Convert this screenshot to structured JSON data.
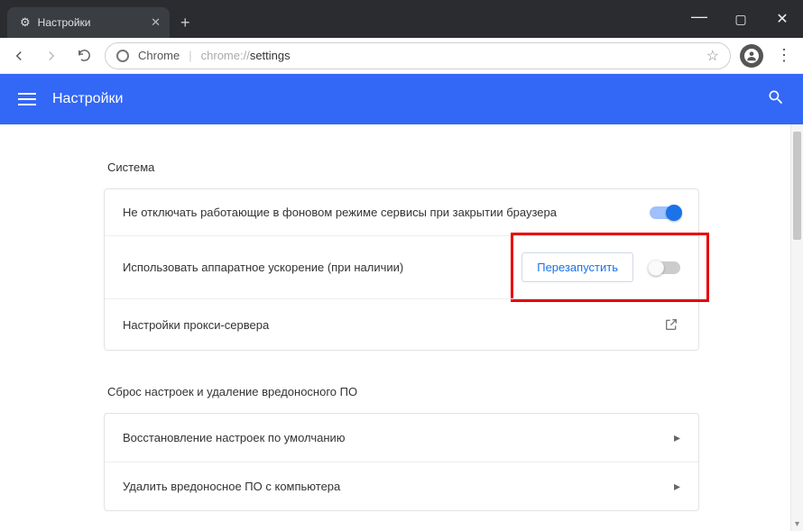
{
  "window": {
    "tab_title": "Настройки"
  },
  "address": {
    "label": "Chrome",
    "url_prefix": "chrome://",
    "url_path": "settings"
  },
  "header": {
    "title": "Настройки"
  },
  "sections": {
    "system": {
      "title": "Система",
      "rows": {
        "background": "Не отключать работающие в фоновом режиме сервисы при закрытии браузера",
        "hwaccel": "Использовать аппаратное ускорение (при наличии)",
        "restart_btn": "Перезапустить",
        "proxy": "Настройки прокси-сервера"
      }
    },
    "reset": {
      "title": "Сброс настроек и удаление вредоносного ПО",
      "rows": {
        "restore": "Восстановление настроек по умолчанию",
        "cleanup": "Удалить вредоносное ПО с компьютера"
      }
    }
  }
}
